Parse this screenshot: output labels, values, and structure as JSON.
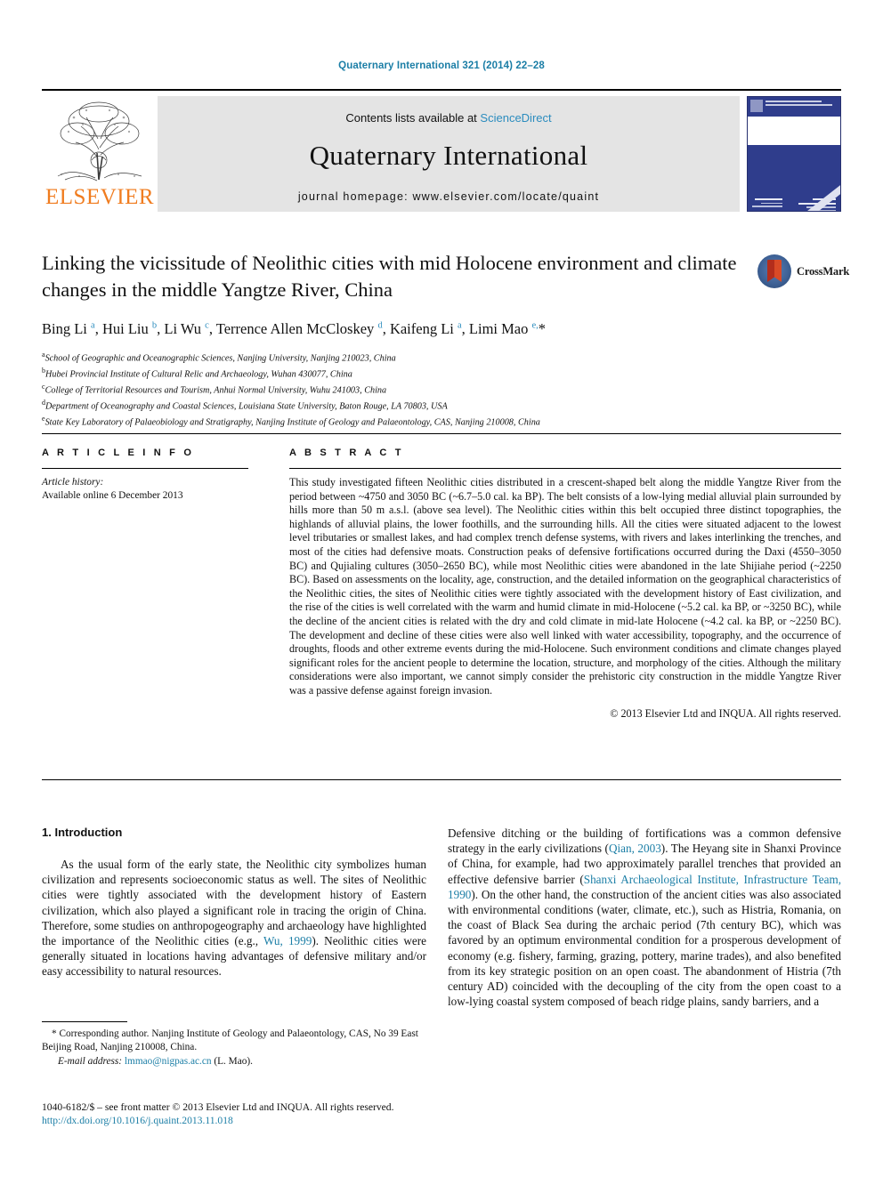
{
  "running_head": "Quaternary International 321 (2014) 22–28",
  "masthead": {
    "publisher_wordmark": "ELSEVIER",
    "contents_prefix": "Contents lists available at",
    "sciencedirect": "ScienceDirect",
    "journal_name": "Quaternary International",
    "homepage": "journal homepage: www.elsevier.com/locate/quaint",
    "cover_alt": "Quaternary International journal cover"
  },
  "article": {
    "title": "Linking the vicissitude of Neolithic cities with mid Holocene environment and climate changes in the middle Yangtze River, China",
    "crossmark_label": "CrossMark",
    "authors_html": "Bing Li <sup>a</sup>, Hui Liu <sup>b</sup>, Li Wu <sup>c</sup>, Terrence Allen McCloskey <sup>d</sup>, Kaifeng Li <sup>a</sup>, Limi Mao <sup>e,</sup>*",
    "affiliations": [
      {
        "marker": "a",
        "text": "School of Geographic and Oceanographic Sciences, Nanjing University, Nanjing 210023, China"
      },
      {
        "marker": "b",
        "text": "Hubei Provincial Institute of Cultural Relic and Archaeology, Wuhan 430077, China"
      },
      {
        "marker": "c",
        "text": "College of Territorial Resources and Tourism, Anhui Normal University, Wuhu 241003, China"
      },
      {
        "marker": "d",
        "text": "Department of Oceanography and Coastal Sciences, Louisiana State University, Baton Rouge, LA 70803, USA"
      },
      {
        "marker": "e",
        "text": "State Key Laboratory of Palaeobiology and Stratigraphy, Nanjing Institute of Geology and Palaeontology, CAS, Nanjing 210008, China"
      }
    ]
  },
  "article_info": {
    "heading": "A R T I C L E   I N F O",
    "history_label": "Article history:",
    "history_value": "Available online 6 December 2013"
  },
  "abstract": {
    "heading": "A B S T R A C T",
    "text": "This study investigated fifteen Neolithic cities distributed in a crescent-shaped belt along the middle Yangtze River from the period between ~4750 and 3050 BC (~6.7–5.0 cal. ka BP). The belt consists of a low-lying medial alluvial plain surrounded by hills more than 50 m a.s.l. (above sea level). The Neolithic cities within this belt occupied three distinct topographies, the highlands of alluvial plains, the lower foothills, and the surrounding hills. All the cities were situated adjacent to the lowest level tributaries or smallest lakes, and had complex trench defense systems, with rivers and lakes interlinking the trenches, and most of the cities had defensive moats. Construction peaks of defensive fortifications occurred during the Daxi (4550–3050 BC) and Qujialing cultures (3050–2650 BC), while most Neolithic cities were abandoned in the late Shijiahe period (~2250 BC). Based on assessments on the locality, age, construction, and the detailed information on the geographical characteristics of the Neolithic cities, the sites of Neolithic cities were tightly associated with the development history of East civilization, and the rise of the cities is well correlated with the warm and humid climate in mid-Holocene (~5.2 cal. ka BP, or ~3250 BC), while the decline of the ancient cities is related with the dry and cold climate in mid-late Holocene (~4.2 cal. ka BP, or ~2250 BC). The development and decline of these cities were also well linked with water accessibility, topography, and the occurrence of droughts, floods and other extreme events during the mid-Holocene. Such environment conditions and climate changes played significant roles for the ancient people to determine the location, structure, and morphology of the cities. Although the military considerations were also important, we cannot simply consider the prehistoric city construction in the middle Yangtze River was a passive defense against foreign invasion.",
    "copyright": "© 2013 Elsevier Ltd and INQUA. All rights reserved."
  },
  "introduction": {
    "heading": "1. Introduction",
    "left_para_1": "As the usual form of the early state, the Neolithic city symbolizes human civilization and represents socioeconomic status as well. The sites of Neolithic cities were tightly associated with the development history of Eastern civilization, which also played a significant role in tracing the origin of China. Therefore, some studies on anthropogeography and archaeology have highlighted the importance of the Neolithic cities (e.g., ",
    "left_cite_1": "Wu, 1999",
    "left_para_1_end": "). Neolithic cities were generally situated in locations having advantages of defensive military and/or easy accessibility to natural resources.",
    "right_para_1_a": "Defensive ditching or the building of fortifications was a common defensive strategy in the early civilizations (",
    "right_cite_1": "Qian, 2003",
    "right_para_1_b": "). The Heyang site in Shanxi Province of China, for example, had two approximately parallel trenches that provided an effective defensive barrier (",
    "right_cite_2": "Shanxi Archaeological Institute, Infrastructure Team, 1990",
    "right_para_1_c": "). On the other hand, the construction of the ancient cities was also associated with environmental conditions (water, climate, etc.), such as Histria, Romania, on the coast of Black Sea during the archaic period (7th century BC), which was favored by an optimum environmental condition for a prosperous development of economy (e.g. fishery, farming, grazing, pottery, marine trades), and also benefited from its key strategic position on an open coast. The abandonment of Histria (7th century AD) coincided with the decoupling of the city from the open coast to a low-lying coastal system composed of beach ridge plains, sandy barriers, and a"
  },
  "footnote": {
    "corresponding": "* Corresponding author. Nanjing Institute of Geology and Palaeontology, CAS, No 39 East Beijing Road, Nanjing 210008, China.",
    "email_label": "E-mail address:",
    "email": "lmmao@nigpas.ac.cn",
    "email_suffix": "(L. Mao)."
  },
  "imprint": {
    "line": "1040-6182/$ – see front matter © 2013 Elsevier Ltd and INQUA. All rights reserved.",
    "doi": "http://dx.doi.org/10.1016/j.quaint.2013.11.018"
  },
  "colors": {
    "link": "#1b7ea6",
    "sciencedirect": "#2b8cbe",
    "elsevier_orange": "#F07C1F",
    "cover_blue": "#2f3d8c",
    "masthead_gray": "#e4e4e4"
  }
}
